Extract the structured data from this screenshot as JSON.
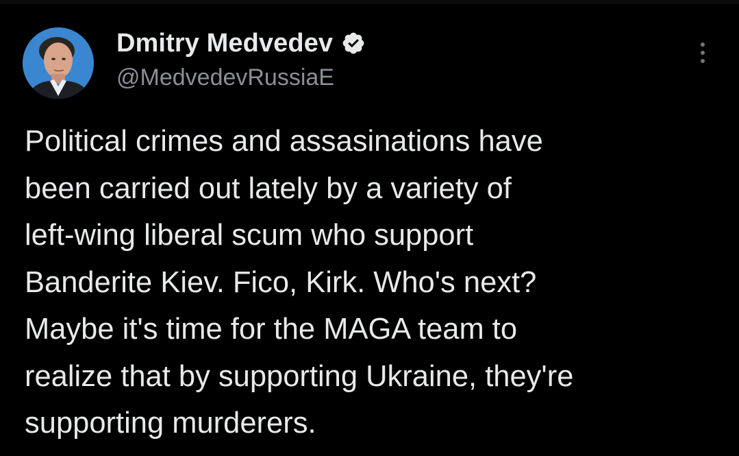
{
  "tweet": {
    "author": {
      "display_name": "Dmitry Medvedev",
      "handle": "@MedvedevRussiaE",
      "verified": true,
      "avatar_icon": "profile-photo"
    },
    "text_lines": [
      "Political crimes and assasinations have",
      "been carried out lately by a variety of",
      "left-wing liberal scum who support",
      "Banderite Kiev. Fico, Kirk. Who's next?",
      "Maybe it's time for the MAGA team to",
      "realize that by supporting Ukraine, they're",
      "supporting murderers."
    ],
    "menu_icon": "more-options-icon"
  },
  "colors": {
    "background": "#000000",
    "text_primary": "#e7e9ea",
    "text_secondary": "#8b9096",
    "verified_badge": "#e7e9ea"
  }
}
